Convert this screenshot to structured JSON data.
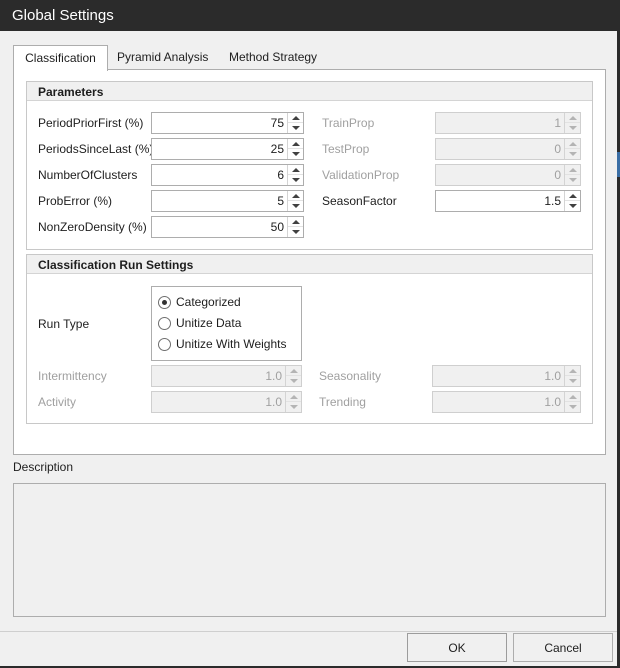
{
  "window": {
    "title": "Global Settings"
  },
  "tabs": [
    {
      "label": "Classification",
      "active": true
    },
    {
      "label": "Pyramid Analysis",
      "active": false
    },
    {
      "label": "Method Strategy",
      "active": false
    }
  ],
  "parameters": {
    "header": "Parameters",
    "left": [
      {
        "label": "PeriodPriorFirst (%)",
        "value": "75"
      },
      {
        "label": "PeriodsSinceLast (%)",
        "value": "25"
      },
      {
        "label": "NumberOfClusters",
        "value": "6"
      },
      {
        "label": "ProbError (%)",
        "value": "5"
      },
      {
        "label": "NonZeroDensity (%)",
        "value": "50"
      }
    ],
    "right": [
      {
        "label": "TrainProp",
        "value": "1",
        "enabled": false
      },
      {
        "label": "TestProp",
        "value": "0",
        "enabled": false
      },
      {
        "label": "ValidationProp",
        "value": "0",
        "enabled": false
      },
      {
        "label": "SeasonFactor",
        "value": "1.5",
        "enabled": true
      }
    ]
  },
  "run_settings": {
    "header": "Classification Run Settings",
    "run_type_label": "Run Type",
    "run_type_options": [
      {
        "label": "Categorized",
        "checked": true
      },
      {
        "label": "Unitize Data",
        "checked": false
      },
      {
        "label": "Unitize With Weights",
        "checked": false
      }
    ],
    "left": [
      {
        "label": "Intermittency",
        "value": "1.0"
      },
      {
        "label": "Activity",
        "value": "1.0"
      }
    ],
    "right": [
      {
        "label": "Seasonality",
        "value": "1.0"
      },
      {
        "label": "Trending",
        "value": "1.0"
      }
    ]
  },
  "description": {
    "label": "Description"
  },
  "buttons": {
    "ok": "OK",
    "cancel": "Cancel"
  },
  "colors": {
    "titlebar": "#2b2b2b",
    "dialog_bg": "#f0f0f0",
    "disabled_text": "#a0a0a0",
    "accent": "#3a6ea5"
  }
}
